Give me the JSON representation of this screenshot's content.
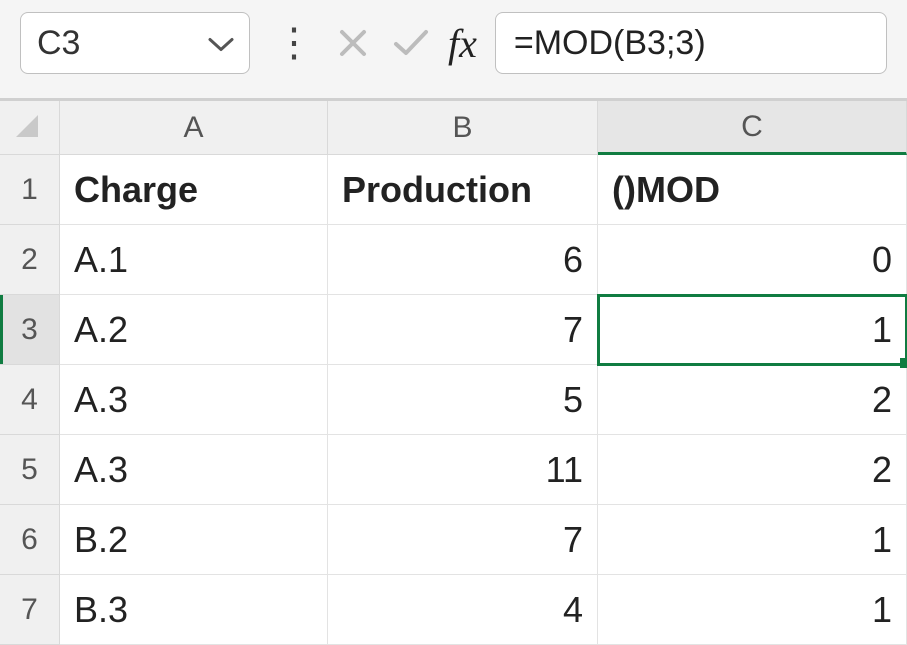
{
  "formula_bar": {
    "cell_ref": "C3",
    "fx_label": "fx",
    "formula": "=MOD(B3;3)"
  },
  "columns": {
    "a": "A",
    "b": "B",
    "c": "C"
  },
  "row_numbers": [
    "1",
    "2",
    "3",
    "4",
    "5",
    "6",
    "7"
  ],
  "headers": {
    "a": "Charge",
    "b": "Production",
    "c": "()MOD"
  },
  "rows": [
    {
      "a": "A.1",
      "b": "6",
      "c": "0"
    },
    {
      "a": "A.2",
      "b": "7",
      "c": "1"
    },
    {
      "a": "A.3",
      "b": "5",
      "c": "2"
    },
    {
      "a": "A.3",
      "b": "11",
      "c": "2"
    },
    {
      "a": "B.2",
      "b": "7",
      "c": "1"
    },
    {
      "a": "B.3",
      "b": "4",
      "c": "1"
    }
  ],
  "selected": {
    "row_index": 1,
    "col": "c"
  }
}
